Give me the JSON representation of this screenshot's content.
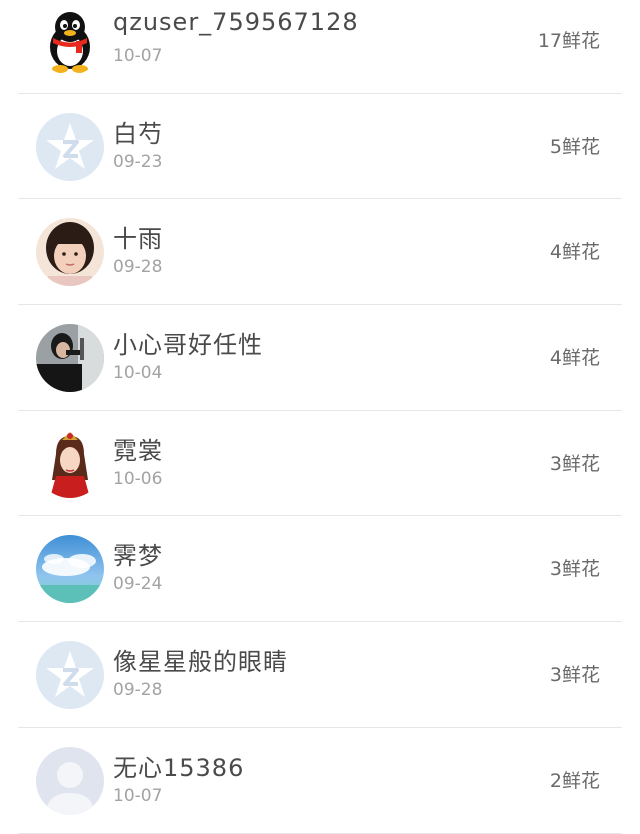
{
  "users": [
    {
      "name": "qzuser_759567128",
      "date": "10-07",
      "flowers": "17鲜花",
      "avatar": "penguin-avatar"
    },
    {
      "name": "白芍",
      "date": "09-23",
      "flowers": "5鲜花",
      "avatar": "default-qzone-avatar"
    },
    {
      "name": "十雨",
      "date": "09-28",
      "flowers": "4鲜花",
      "avatar": "photo-avatar"
    },
    {
      "name": "小心哥好任性",
      "date": "10-04",
      "flowers": "4鲜花",
      "avatar": "photo-avatar"
    },
    {
      "name": "霓裳",
      "date": "10-06",
      "flowers": "3鲜花",
      "avatar": "illustration-avatar"
    },
    {
      "name": "霁梦",
      "date": "09-24",
      "flowers": "3鲜花",
      "avatar": "sky-avatar"
    },
    {
      "name": "像星星般的眼睛",
      "date": "09-28",
      "flowers": "3鲜花",
      "avatar": "default-qzone-avatar"
    },
    {
      "name": "无心15386",
      "date": "10-07",
      "flowers": "2鲜花",
      "avatar": "default-silhouette-avatar"
    }
  ],
  "colors": {
    "name_text": "#4a4a4a",
    "date_text": "#a3a3a3",
    "count_text": "#6a6a6a",
    "divider": "#e6e6e6",
    "default_avatar_bg": "#dde8f3"
  }
}
